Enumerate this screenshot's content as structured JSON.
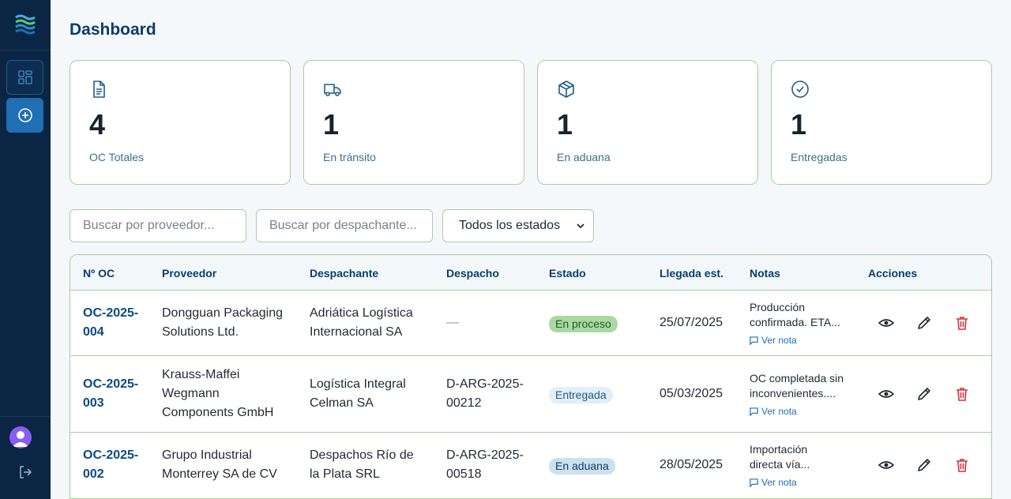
{
  "page": {
    "title": "Dashboard"
  },
  "colors": {
    "sidebar": "#0b2545",
    "accent": "#1f6fb2",
    "border": "#a6cf9f",
    "danger": "#d1343c"
  },
  "sidebar": {
    "items": [
      {
        "name": "dashboard",
        "icon": "grid-icon"
      },
      {
        "name": "new-order",
        "icon": "plus-circle-icon"
      }
    ]
  },
  "stats": [
    {
      "icon": "document-icon",
      "value": "4",
      "label": "OC Totales"
    },
    {
      "icon": "truck-icon",
      "value": "1",
      "label": "En tránsito"
    },
    {
      "icon": "package-icon",
      "value": "1",
      "label": "En aduana"
    },
    {
      "icon": "check-circle-icon",
      "value": "1",
      "label": "Entregadas"
    }
  ],
  "filters": {
    "provider_placeholder": "Buscar por proveedor...",
    "broker_placeholder": "Buscar por despachante...",
    "status_selected": "Todos los estados"
  },
  "table": {
    "headers": [
      "Nº OC",
      "Proveedor",
      "Despachante",
      "Despacho",
      "Estado",
      "Llegada est.",
      "Notas",
      "Acciones"
    ],
    "rows": [
      {
        "oc_line1": "OC-2025-",
        "oc_line2": "004",
        "provider": [
          "Dongguan Packaging",
          "Solutions Ltd."
        ],
        "broker": [
          "Adriática Logística",
          "Internacional SA"
        ],
        "dispatch": [
          "—"
        ],
        "status": "En proceso",
        "status_kind": "proceso",
        "arrival": "25/07/2025",
        "note": [
          "Producción",
          "confirmada. ETA..."
        ],
        "note_link": "Ver nota"
      },
      {
        "oc_line1": "OC-2025-",
        "oc_line2": "003",
        "provider": [
          "Krauss-Maffei",
          "Wegmann",
          "Components GmbH"
        ],
        "broker": [
          "Logística Integral",
          "Celman SA"
        ],
        "dispatch": [
          "D-ARG-2025-",
          "00212"
        ],
        "status": "Entregada",
        "status_kind": "entregada",
        "arrival": "05/03/2025",
        "note": [
          "OC completada sin",
          "inconvenientes...."
        ],
        "note_link": "Ver nota"
      },
      {
        "oc_line1": "OC-2025-",
        "oc_line2": "002",
        "provider": [
          "Grupo Industrial",
          "Monterrey SA de CV"
        ],
        "broker": [
          "Despachos Río de",
          "la Plata SRL"
        ],
        "dispatch": [
          "D-ARG-2025-",
          "00518"
        ],
        "status": "En aduana",
        "status_kind": "aduana",
        "arrival": "28/05/2025",
        "note": [
          "Importación",
          "directa vía..."
        ],
        "note_link": "Ver nota"
      }
    ]
  }
}
